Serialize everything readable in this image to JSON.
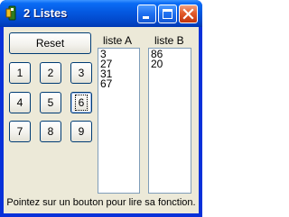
{
  "window": {
    "title": "2 Listes",
    "title_color": "#ffffff",
    "titlebar_color": "#0458e0",
    "client_color": "#ece9d8",
    "close_color": "#e35b2b"
  },
  "titlebar_buttons": [
    {
      "icon": "minimize-icon"
    },
    {
      "icon": "maximize-icon"
    },
    {
      "icon": "close-icon"
    }
  ],
  "buttons": {
    "reset": "Reset",
    "numbers": [
      "1",
      "2",
      "3",
      "4",
      "5",
      "6",
      "7",
      "8",
      "9"
    ],
    "focused": "6"
  },
  "lists": {
    "a": {
      "label": "liste A",
      "items": [
        "3",
        "27",
        "31",
        "67"
      ]
    },
    "b": {
      "label": "liste B",
      "items": [
        "86",
        "20"
      ]
    }
  },
  "status": "Pointez sur un bouton pour lire sa fonction."
}
